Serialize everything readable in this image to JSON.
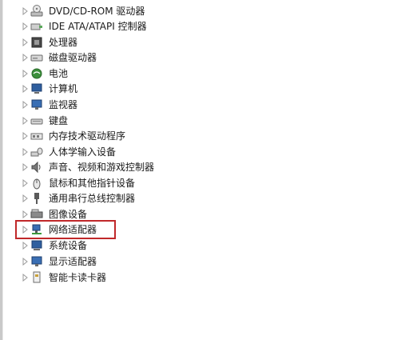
{
  "devices": [
    {
      "label": "DVD/CD-ROM 驱动器",
      "icon": "dvd-drive-icon"
    },
    {
      "label": "IDE ATA/ATAPI 控制器",
      "icon": "ide-controller-icon"
    },
    {
      "label": "处理器",
      "icon": "processor-icon"
    },
    {
      "label": "磁盘驱动器",
      "icon": "disk-drive-icon"
    },
    {
      "label": "电池",
      "icon": "battery-icon"
    },
    {
      "label": "计算机",
      "icon": "computer-icon"
    },
    {
      "label": "监视器",
      "icon": "monitor-icon"
    },
    {
      "label": "键盘",
      "icon": "keyboard-icon"
    },
    {
      "label": "内存技术驱动程序",
      "icon": "memory-tech-icon"
    },
    {
      "label": "人体学输入设备",
      "icon": "hid-icon"
    },
    {
      "label": "声音、视频和游戏控制器",
      "icon": "sound-icon"
    },
    {
      "label": "鼠标和其他指针设备",
      "icon": "mouse-icon"
    },
    {
      "label": "通用串行总线控制器",
      "icon": "usb-icon"
    },
    {
      "label": "图像设备",
      "icon": "imaging-icon"
    },
    {
      "label": "网络适配器",
      "icon": "network-adapter-icon",
      "highlighted": true
    },
    {
      "label": "系统设备",
      "icon": "system-device-icon"
    },
    {
      "label": "显示适配器",
      "icon": "display-adapter-icon"
    },
    {
      "label": "智能卡读卡器",
      "icon": "smart-card-icon"
    }
  ],
  "colors": {
    "highlight_border": "#c0282a",
    "arrow": "#9a9a9a"
  }
}
